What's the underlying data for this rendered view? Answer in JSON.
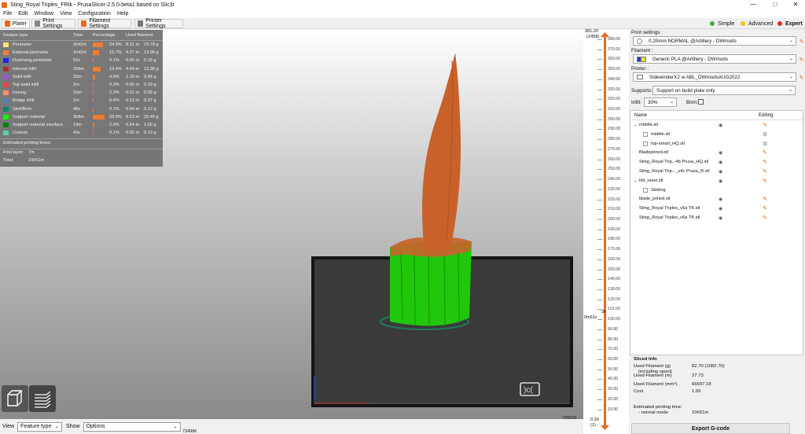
{
  "window": {
    "title": "Sting_Royal Triples_FRtk - PrusaSlicer-2.5.0-beta1 based on Slic3r",
    "controls": [
      "—",
      "□",
      "✕"
    ]
  },
  "menu": [
    "File",
    "Edit",
    "Window",
    "View",
    "Configuration",
    "Help"
  ],
  "tabs": [
    "Plater",
    "Print Settings",
    "Filament Settings",
    "Printer Settings"
  ],
  "modes": [
    {
      "label": "Simple",
      "color": "#3cb043"
    },
    {
      "label": "Advanced",
      "color": "#f5c518"
    },
    {
      "label": "Expert",
      "color": "#e02b20"
    }
  ],
  "legend": {
    "headers": [
      "Feature type",
      "Time",
      "Percentage",
      "Used filament"
    ],
    "rows": [
      {
        "name": "Perimeter",
        "color": "#ffe66b",
        "time": "2h42m",
        "pct": "24.9%",
        "pct_value": 24.9,
        "len": "8.31 m",
        "weight": "24.79 g"
      },
      {
        "name": "External perimeter",
        "color": "#ff7d38",
        "time": "1h42m",
        "pct": "15.7%",
        "pct_value": 15.7,
        "len": "4.37 m",
        "weight": "13.05 g"
      },
      {
        "name": "Overhang perimeter",
        "color": "#1f1fff",
        "time": "52s",
        "pct": "0.1%",
        "pct_value": 0.1,
        "len": "0.05 m",
        "weight": "0.15 g"
      },
      {
        "name": "Internal infill",
        "color": "#b03029",
        "time": "2h6m",
        "pct": "19.4%",
        "pct_value": 19.4,
        "len": "4.49 m",
        "weight": "13.38 g"
      },
      {
        "name": "Solid infill",
        "color": "#9654cc",
        "time": "32m",
        "pct": "4.9%",
        "pct_value": 4.9,
        "len": "1.16 m",
        "weight": "3.45 g"
      },
      {
        "name": "Top solid infill",
        "color": "#f04040",
        "time": "2m",
        "pct": "0.3%",
        "pct_value": 0.3,
        "len": "0.06 m",
        "weight": "0.19 g"
      },
      {
        "name": "Ironing",
        "color": "#ff8c69",
        "time": "15m",
        "pct": "2.3%",
        "pct_value": 2.3,
        "len": "0.01 m",
        "weight": "0.02 g"
      },
      {
        "name": "Bridge infill",
        "color": "#4d80ba",
        "time": "2m",
        "pct": "0.4%",
        "pct_value": 0.4,
        "len": "0.13 m",
        "weight": "0.37 g"
      },
      {
        "name": "Skirt/Brim",
        "color": "#00876e",
        "time": "46s",
        "pct": "0.1%",
        "pct_value": 0.1,
        "len": "0.04 m",
        "weight": "0.12 g"
      },
      {
        "name": "Support material",
        "color": "#00ff00",
        "time": "3h8m",
        "pct": "28.9%",
        "pct_value": 28.9,
        "len": "8.53 m",
        "weight": "25.45 g"
      },
      {
        "name": "Support material interface",
        "color": "#008000",
        "time": "19m",
        "pct": "2.9%",
        "pct_value": 2.9,
        "len": "0.54 m",
        "weight": "1.60 g"
      },
      {
        "name": "Custom",
        "color": "#5ed1a8",
        "time": "43s",
        "pct": "0.1%",
        "pct_value": 0.1,
        "len": "0.05 m",
        "weight": "0.13 g"
      }
    ],
    "estimated_title": "Estimated printing times:",
    "first_layer_label": "First layer:",
    "first_layer_value": "7m",
    "total_label": "Total:",
    "total_value": "10h51m"
  },
  "bottombar": {
    "view_label": "View",
    "view_value": "Feature type",
    "show_label": "Show",
    "show_value": "Options",
    "h_value": "735023",
    "h_value2": "734986"
  },
  "vslider": {
    "top_value": "381.20",
    "top_sub": "(2458)",
    "ticks": [
      "380.00",
      "370.00",
      "360.00",
      "350.00",
      "340.00",
      "330.00",
      "320.00",
      "310.00",
      "300.00",
      "290.00",
      "280.00",
      "270.00",
      "260.00",
      "250.00",
      "240.00",
      "230.00",
      "220.00",
      "210.00",
      "200.00",
      "190.00",
      "180.00",
      "170.00",
      "160.00",
      "150.00",
      "140.00",
      "130.00",
      "120.00",
      "110.00",
      "100.00",
      "90.00",
      "80.00",
      "70.00",
      "60.00",
      "50.00",
      "40.00",
      "30.00",
      "20.00",
      "10.00"
    ],
    "time_a": "3h",
    "time_b": "0m52s",
    "bottom_value": "0.30",
    "bottom_sub": "(1)"
  },
  "right": {
    "print_settings_label": "Print settings :",
    "print_settings_value": "0.20mm NORMAL @Artillery - DWmods",
    "filament_label": "Filament :",
    "filament_value": "Generic PLA @Artillery - DWmods",
    "filament_color": "#f5e51e",
    "printer_label": "Printer :",
    "printer_value": "SidewinderX2 w ABL_DWmodsAUG2022",
    "supports_label": "Supports:",
    "supports_value": "Support on build plate only",
    "infill_label": "Infill:",
    "infill_value": "30%",
    "brim_label": "Brim:",
    "list_headers": [
      "Name",
      "Editing"
    ],
    "objects": [
      {
        "name": "middle.stl",
        "indent": 0,
        "expander": "v",
        "eye": true,
        "edit": "edit"
      },
      {
        "name": "middle.stl",
        "indent": 1,
        "expander": "",
        "eye": false,
        "edit": "gear"
      },
      {
        "name": "top-smart_HQ.stl",
        "indent": 1,
        "expander": "",
        "eye": false,
        "edit": "gear"
      },
      {
        "name": "Bladejoined.stl",
        "indent": 0,
        "expander": "",
        "eye": true,
        "edit": "edit"
      },
      {
        "name": "Sting_Royal Trip...4b Prusa_HQ.stl",
        "indent": 0,
        "expander": "",
        "eye": true,
        "edit": "edit"
      },
      {
        "name": "Sting_Royal Trip..._v4c Prusa_R.stl",
        "indent": 0,
        "expander": "",
        "eye": true,
        "edit": "edit"
      },
      {
        "name": "hilt_reset.stl",
        "indent": 0,
        "expander": "v",
        "eye": true,
        "edit": "edit"
      },
      {
        "name": "Sinking",
        "indent": 1,
        "expander": "",
        "eye": false,
        "edit": ""
      },
      {
        "name": "blade_joined.stl",
        "indent": 0,
        "expander": "",
        "eye": true,
        "edit": "edit"
      },
      {
        "name": "Sting_Royal Triples_v5a TK.stl",
        "indent": 0,
        "expander": "",
        "eye": true,
        "edit": "edit"
      },
      {
        "name": "Sting_Royal Triples_v6a TK.stl",
        "indent": 0,
        "expander": "",
        "eye": true,
        "edit": "edit"
      }
    ],
    "sliced_title": "Sliced Info",
    "sliced": [
      {
        "k": "Used Filament (g)",
        "k2": "(including spool)",
        "v": "82.70 (1082.70)"
      },
      {
        "k": "Used Filament (m)",
        "k2": "",
        "v": "27.73"
      },
      {
        "k": "Used Filament (mm³)",
        "k2": "",
        "v": "66697.18"
      },
      {
        "k": "Cost",
        "k2": "",
        "v": "1.65"
      },
      {
        "k": "Estimated printing time:",
        "k2": "- normal mode",
        "v": "10h51m"
      }
    ],
    "export_label": "Export G-code"
  },
  "colors": {
    "accent": "#e56b1f",
    "model_orange": "#c8622a",
    "support_green": "#21c70b",
    "bed": "#3a3a3a"
  }
}
